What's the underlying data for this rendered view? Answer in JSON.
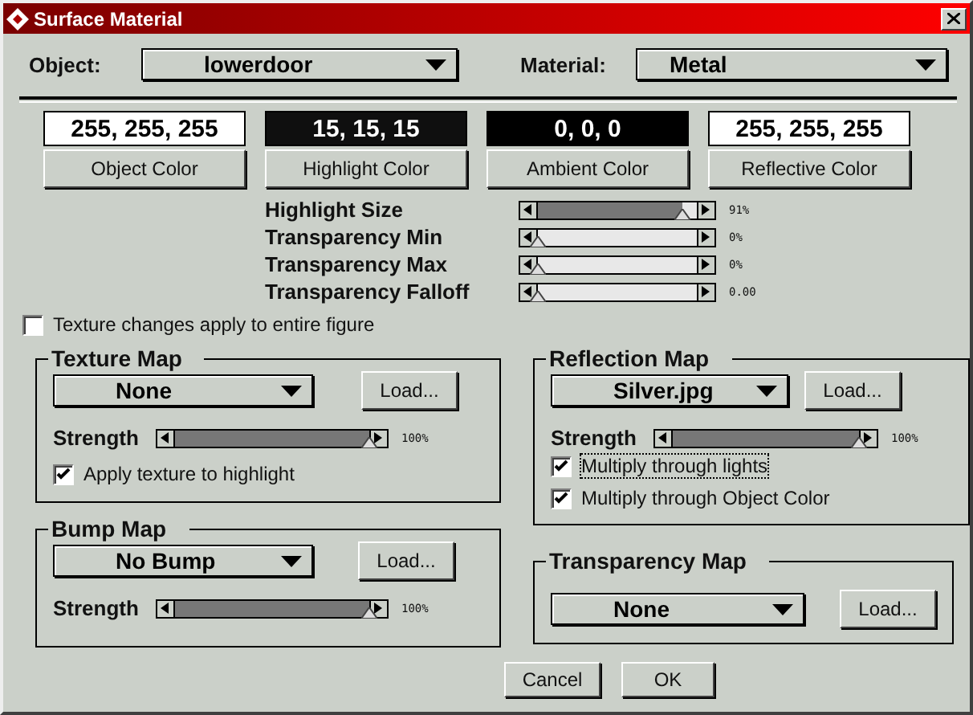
{
  "window": {
    "title": "Surface Material"
  },
  "object": {
    "label": "Object:",
    "value": "lowerdoor"
  },
  "material": {
    "label": "Material:",
    "value": "Metal"
  },
  "colors": [
    {
      "value": "255, 255, 255",
      "color": "#ffffff",
      "button": "Object Color"
    },
    {
      "value": "15, 15, 15",
      "color": "#0f0f0f",
      "button": "Highlight Color"
    },
    {
      "value": "0, 0, 0",
      "color": "#000000",
      "button": "Ambient Color"
    },
    {
      "value": "255, 255, 255",
      "color": "#ffffff",
      "button": "Reflective Color"
    }
  ],
  "properties": [
    {
      "label": "Highlight Size",
      "level": 0.91,
      "reading": "91%"
    },
    {
      "label": "Transparency Min",
      "level": 0,
      "reading": "0%"
    },
    {
      "label": "Transparency Max",
      "level": 0,
      "reading": "0%"
    },
    {
      "label": "Transparency Falloff",
      "level": 0,
      "reading": "0.00"
    }
  ],
  "texture_changes": {
    "label": "Texture changes apply to entire figure",
    "checked": false
  },
  "texture_map": {
    "title": "Texture Map",
    "value": "None",
    "load": "Load...",
    "strength": {
      "label": "Strength",
      "level": 1,
      "reading": "100%"
    },
    "options": [
      {
        "label": "Apply texture to highlight",
        "checked": true,
        "focused": false
      }
    ]
  },
  "bump_map": {
    "title": "Bump Map",
    "value": "No Bump",
    "load": "Load...",
    "strength": {
      "label": "Strength",
      "level": 1,
      "reading": "100%"
    }
  },
  "reflection_map": {
    "title": "Reflection Map",
    "value": "Silver.jpg",
    "load": "Load...",
    "strength": {
      "label": "Strength",
      "level": 1,
      "reading": "100%"
    },
    "options": [
      {
        "label": "Multiply through lights",
        "checked": true,
        "focused": true
      },
      {
        "label": "Multiply through Object Color",
        "checked": true,
        "focused": false
      }
    ]
  },
  "transparency_map": {
    "title": "Transparency Map",
    "value": "None",
    "load": "Load..."
  },
  "buttons": [
    "Cancel",
    "OK"
  ]
}
